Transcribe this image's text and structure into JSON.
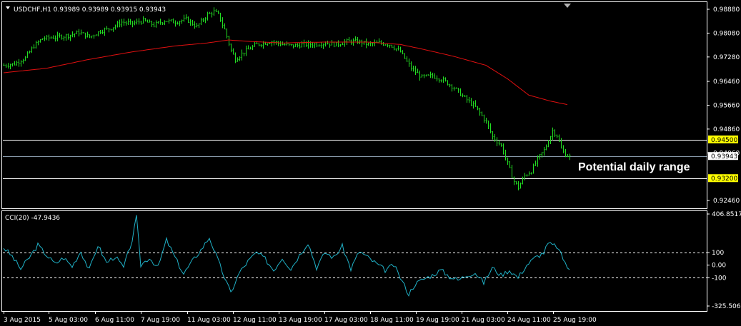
{
  "window": {
    "symbol_header": "USDCHF,H1  0.93989 0.93989 0.93915 0.93943",
    "indicator_header": "CCI(20) -47.9436",
    "annotation": "Potential daily range"
  },
  "colors": {
    "background": "#000000",
    "candles": "#22dd22",
    "moving_average": "#e01010",
    "cci": "#20b2c8",
    "horizontal_line": "#ffffff",
    "grid_border": "#ffffff",
    "level_badge": "#ffff00",
    "current_badge": "#ffffff"
  },
  "chart_data": [
    {
      "type": "line",
      "subtype": "bar_ohlc",
      "title": "USDCHF,H1",
      "ylim": [
        0.922,
        0.9912
      ],
      "y_ticks": [
        "0.98880",
        "0.98080",
        "0.97280",
        "0.96460",
        "0.95660",
        "0.94860",
        "0.94060",
        "0.92460"
      ],
      "x_ticks": [
        "3 Aug 2015",
        "5 Aug 03:00",
        "6 Aug 11:00",
        "7 Aug 19:00",
        "11 Aug 03:00",
        "12 Aug 11:00",
        "13 Aug 19:00",
        "17 Aug 03:00",
        "18 Aug 11:00",
        "19 Aug 19:00",
        "21 Aug 03:00",
        "24 Aug 11:00",
        "25 Aug 19:00"
      ],
      "horizontal_levels": [
        {
          "value": 0.945,
          "label": "0.94500"
        },
        {
          "value": 0.932,
          "label": "0.93200"
        }
      ],
      "current_price": {
        "value": 0.93943,
        "label": "0.93943"
      },
      "series": [
        {
          "style": "price",
          "keypoints": [
            [
              0,
              0.97
            ],
            [
              5,
              0.9705
            ],
            [
              10,
              0.9725
            ],
            [
              14,
              0.9765
            ],
            [
              18,
              0.979
            ],
            [
              25,
              0.9795
            ],
            [
              30,
              0.98
            ],
            [
              35,
              0.981
            ],
            [
              40,
              0.9795
            ],
            [
              45,
              0.9815
            ],
            [
              50,
              0.9825
            ],
            [
              55,
              0.9845
            ],
            [
              60,
              0.984
            ],
            [
              65,
              0.985
            ],
            [
              70,
              0.9835
            ],
            [
              75,
              0.985
            ],
            [
              80,
              0.9845
            ],
            [
              85,
              0.9855
            ],
            [
              90,
              0.983
            ],
            [
              95,
              0.987
            ],
            [
              98,
              0.988
            ],
            [
              100,
              0.987
            ],
            [
              103,
              0.982
            ],
            [
              106,
              0.975
            ],
            [
              108,
              0.972
            ],
            [
              112,
              0.9745
            ],
            [
              118,
              0.977
            ],
            [
              125,
              0.978
            ],
            [
              130,
              0.977
            ],
            [
              135,
              0.9765
            ],
            [
              140,
              0.977
            ],
            [
              145,
              0.977
            ],
            [
              150,
              0.9775
            ],
            [
              155,
              0.977
            ],
            [
              160,
              0.978
            ],
            [
              165,
              0.978
            ],
            [
              170,
              0.977
            ],
            [
              175,
              0.9775
            ],
            [
              180,
              0.977
            ],
            [
              185,
              0.9745
            ],
            [
              190,
              0.969
            ],
            [
              195,
              0.966
            ],
            [
              200,
              0.9665
            ],
            [
              205,
              0.965
            ],
            [
              210,
              0.9625
            ],
            [
              215,
              0.959
            ],
            [
              220,
              0.956
            ],
            [
              225,
              0.951
            ],
            [
              228,
              0.946
            ],
            [
              232,
              0.943
            ],
            [
              235,
              0.937
            ],
            [
              238,
              0.931
            ],
            [
              240,
              0.929
            ],
            [
              243,
              0.933
            ],
            [
              246,
              0.9345
            ],
            [
              249,
              0.9385
            ],
            [
              252,
              0.9415
            ],
            [
              254,
              0.9445
            ],
            [
              256,
              0.948
            ],
            [
              258,
              0.9465
            ],
            [
              260,
              0.942
            ],
            [
              262,
              0.94
            ],
            [
              264,
              0.9394
            ]
          ]
        },
        {
          "style": "moving_average",
          "keypoints": [
            [
              0,
              0.9675
            ],
            [
              20,
              0.969
            ],
            [
              40,
              0.972
            ],
            [
              60,
              0.9745
            ],
            [
              80,
              0.9765
            ],
            [
              95,
              0.9775
            ],
            [
              105,
              0.9785
            ],
            [
              115,
              0.978
            ],
            [
              130,
              0.9775
            ],
            [
              150,
              0.9778
            ],
            [
              170,
              0.9778
            ],
            [
              185,
              0.977
            ],
            [
              195,
              0.9755
            ],
            [
              210,
              0.973
            ],
            [
              225,
              0.97
            ],
            [
              235,
              0.9655
            ],
            [
              245,
              0.96
            ],
            [
              255,
              0.958
            ],
            [
              263,
              0.9568
            ]
          ]
        }
      ]
    },
    {
      "type": "line",
      "title": "CCI(20)",
      "ylim": [
        -325.5062,
        406.8517
      ],
      "y_ticks": [
        "406.8517",
        "100",
        "0.00",
        "-100",
        "-325.5062"
      ],
      "reference_levels": [
        100,
        -100
      ],
      "series": [
        {
          "style": "cci",
          "keypoints": [
            [
              0,
              140
            ],
            [
              4,
              70
            ],
            [
              8,
              -30
            ],
            [
              12,
              60
            ],
            [
              16,
              160
            ],
            [
              20,
              80
            ],
            [
              24,
              10
            ],
            [
              28,
              60
            ],
            [
              32,
              -10
            ],
            [
              36,
              110
            ],
            [
              40,
              -40
            ],
            [
              44,
              160
            ],
            [
              48,
              20
            ],
            [
              52,
              70
            ],
            [
              56,
              -20
            ],
            [
              60,
              200
            ],
            [
              62,
              380
            ],
            [
              64,
              0
            ],
            [
              68,
              60
            ],
            [
              72,
              -20
            ],
            [
              76,
              200
            ],
            [
              80,
              60
            ],
            [
              84,
              -70
            ],
            [
              88,
              30
            ],
            [
              92,
              120
            ],
            [
              96,
              220
            ],
            [
              100,
              40
            ],
            [
              104,
              -140
            ],
            [
              106,
              -220
            ],
            [
              110,
              -60
            ],
            [
              114,
              30
            ],
            [
              118,
              100
            ],
            [
              122,
              50
            ],
            [
              126,
              -40
            ],
            [
              130,
              60
            ],
            [
              134,
              -30
            ],
            [
              138,
              80
            ],
            [
              142,
              180
            ],
            [
              146,
              -20
            ],
            [
              150,
              100
            ],
            [
              154,
              60
            ],
            [
              158,
              150
            ],
            [
              162,
              -30
            ],
            [
              166,
              110
            ],
            [
              170,
              60
            ],
            [
              174,
              10
            ],
            [
              178,
              -40
            ],
            [
              182,
              0
            ],
            [
              186,
              -130
            ],
            [
              189,
              -230
            ],
            [
              192,
              -150
            ],
            [
              196,
              -110
            ],
            [
              200,
              -80
            ],
            [
              204,
              -40
            ],
            [
              208,
              -90
            ],
            [
              212,
              -120
            ],
            [
              216,
              -80
            ],
            [
              220,
              -60
            ],
            [
              224,
              -140
            ],
            [
              228,
              -20
            ],
            [
              232,
              -80
            ],
            [
              236,
              -40
            ],
            [
              240,
              -100
            ],
            [
              244,
              0
            ],
            [
              248,
              60
            ],
            [
              252,
              100
            ],
            [
              254,
              170
            ],
            [
              258,
              150
            ],
            [
              262,
              20
            ],
            [
              264,
              -48
            ]
          ]
        }
      ]
    }
  ]
}
